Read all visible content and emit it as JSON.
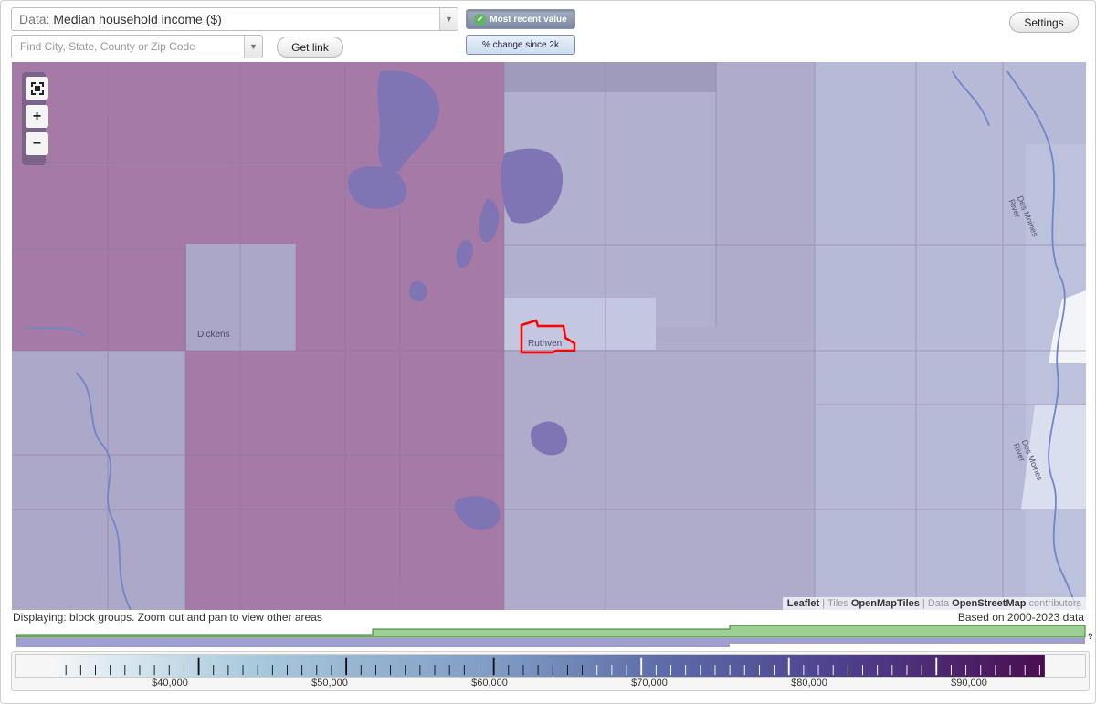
{
  "toolbar": {
    "data_prefix": "Data:",
    "data_value": "Median household income ($)",
    "search_placeholder": "Find City, State, County or Zip Code",
    "get_link_label": "Get link",
    "most_recent_label": "Most recent value",
    "pct_change_label": "% change since 2k",
    "settings_label": "Settings"
  },
  "map": {
    "place_labels": [
      "Dickens",
      "Ruthven"
    ],
    "river_labels": [
      "Des Moines River",
      "Des Moines River"
    ],
    "zoom_in_symbol": "+",
    "zoom_out_symbol": "−",
    "attribution": {
      "leaflet": "Leaflet",
      "sep1": "|",
      "tiles_prefix": "Tiles",
      "tiles_name": "OpenMapTiles",
      "sep2": "|",
      "data_prefix": "Data",
      "data_name": "OpenStreetMap",
      "contributors": "contributors"
    },
    "colors": {
      "high_region": "#a57aa6",
      "mid_region": "#aaa7c9",
      "low_region": "#bfc4dc",
      "water": "#7f74b4",
      "selected_outline": "#ff0000"
    }
  },
  "footer": {
    "displaying": "Displaying: block groups. Zoom out and pan to view other areas",
    "based_on": "Based on 2000-2023 data",
    "help_symbol": "?"
  },
  "legend": {
    "labels": [
      "$40,000",
      "$50,000",
      "$60,000",
      "$70,000",
      "$80,000",
      "$90,000"
    ],
    "gradient_colors": [
      "#f2f6f8",
      "#a9c9dc",
      "#7f9ac4",
      "#5c6aa6",
      "#4e3f8c",
      "#4a0e4e"
    ]
  },
  "icons": {
    "fullscreen": "fullscreen-icon",
    "zoom_in": "zoom-in-icon",
    "zoom_out": "zoom-out-icon",
    "check": "check-icon",
    "dropdown": "chevron-down-icon"
  }
}
